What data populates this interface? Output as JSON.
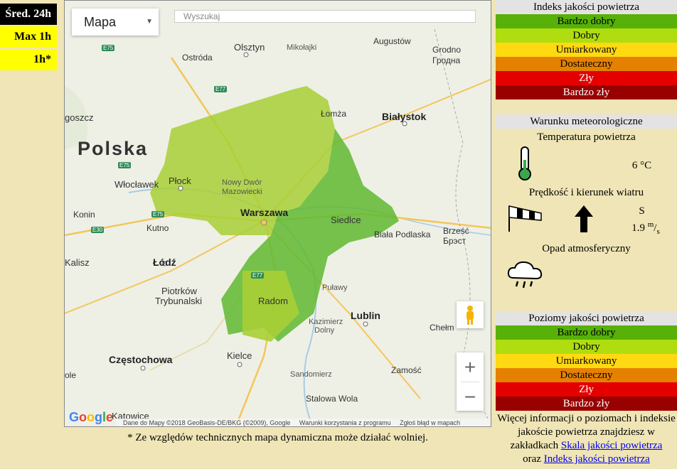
{
  "left_buttons": {
    "avg24": "Śred. 24h",
    "max1h": "Max 1h",
    "h1": "1h*"
  },
  "map": {
    "type_label": "Mapa",
    "search_placeholder": "Wyszukaj",
    "country_label": "Polska",
    "cities": {
      "olsztyn": "Olsztyn",
      "mikolajki": "Mikołajki",
      "augustow": "Augustów",
      "grodno": "Grodno",
      "grodno_ru": "Гродна",
      "ostroda": "Ostróda",
      "lomza": "Łomża",
      "bialystok": "Białystok",
      "goszcz": "goszcz",
      "plock": "Płock",
      "nowy_dwor": "Nowy Dwór",
      "mazowiecki": "Mazowiecki",
      "wloclawek": "Włocławek",
      "warszawa": "Warszawa",
      "siedlce": "Siedlce",
      "konin": "Konin",
      "kutno": "Kutno",
      "biala_podlaska": "Biała Podlaska",
      "brzesc": "Brześć",
      "brzesc_ru": "Брэст",
      "kalisz": "Kalisz",
      "lodz": "Łódź",
      "piotrkow": "Piotrków",
      "trybunalski": "Trybunalski",
      "radom": "Radom",
      "pulawy": "Puławy",
      "lublin": "Lublin",
      "kazimierz": "Kazimierz",
      "dolny": "Dolny",
      "chelm": "Chełm",
      "czestochowa": "Częstochowa",
      "kielce": "Kielce",
      "sandomierz": "Sandomierz",
      "zamosc": "Zamość",
      "stalowa_wola": "Stalowa Wola",
      "katowice": "Katowice",
      "ole": "ole"
    },
    "roads": [
      "E75",
      "E77",
      "E75",
      "E30",
      "E77",
      "E75"
    ],
    "google_logo": "Google",
    "attribution": "Dane do Mapy ©2018 GeoBasis-DE/BKG (©2009), Google",
    "terms": "Warunki korzystania z programu",
    "report": "Zgłoś błąd w mapach",
    "zoom_in": "+",
    "zoom_out": "−",
    "colors": {
      "yellow_green": "#a8cf35",
      "green": "#5fb830"
    }
  },
  "note": "* Ze względów technicznych mapa dynamiczna może działać wolniej.",
  "index_panel": {
    "title": "Indeks jakości powietrza",
    "levels": [
      {
        "label": "Bardzo dobry",
        "color": "#57b108"
      },
      {
        "label": "Dobry",
        "color": "#b0dd10"
      },
      {
        "label": "Umiarkowany",
        "color": "#ffd911"
      },
      {
        "label": "Dostateczny",
        "color": "#e58100"
      },
      {
        "label": "Zły",
        "color": "#e50000"
      },
      {
        "label": "Bardzo zły",
        "color": "#990000"
      }
    ]
  },
  "meteo": {
    "title": "Warunku meteorologiczne",
    "temp_title": "Temperatura powietrza",
    "temp_value": "6 °C",
    "wind_title": "Prędkość i kierunek wiatru",
    "wind_dir": "S",
    "wind_speed": "1.9",
    "wind_unit_num": "m",
    "wind_unit_den": "s",
    "precip_title": "Opad atmosferyczny"
  },
  "levels_panel": {
    "title": "Poziomy jakości powietrza",
    "levels": [
      {
        "label": "Bardzo dobry",
        "color": "#57b108"
      },
      {
        "label": "Dobry",
        "color": "#b0dd10"
      },
      {
        "label": "Umiarkowany",
        "color": "#ffd911"
      },
      {
        "label": "Dostateczny",
        "color": "#e58100"
      },
      {
        "label": "Zły",
        "color": "#e50000"
      },
      {
        "label": "Bardzo zły",
        "color": "#990000"
      }
    ]
  },
  "more_info": {
    "text1": "Więcej informacji o poziomach i indeksie jakoście powietrza znajdziesz w zakładkach",
    "link1": "Skala jakości powietrza",
    "text2": "oraz",
    "link2": "Indeks jakości powietrza"
  }
}
